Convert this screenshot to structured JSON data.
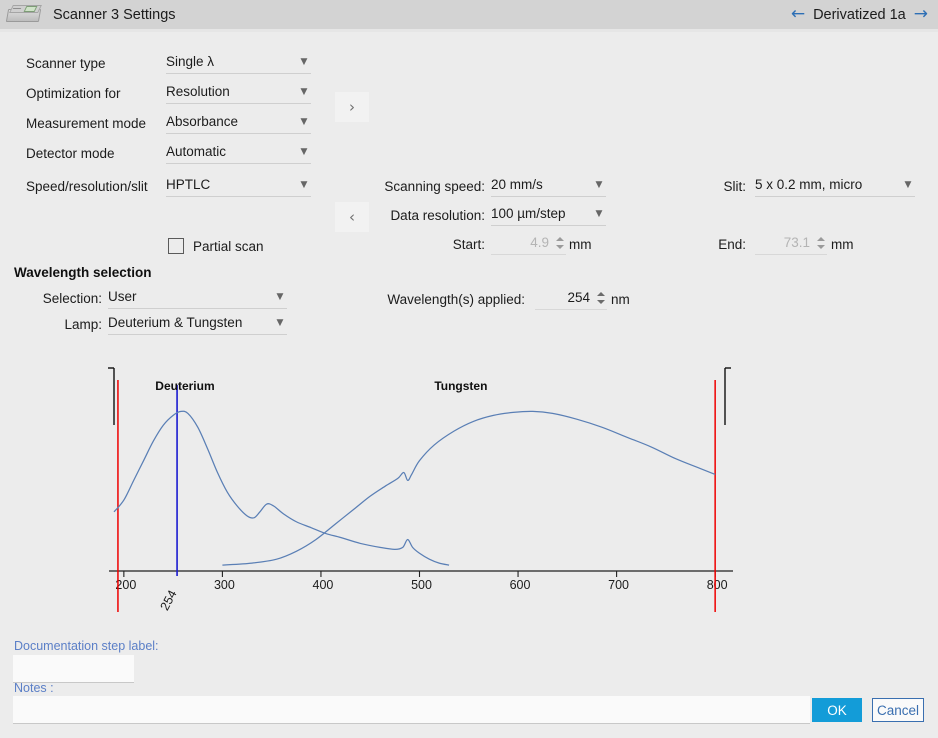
{
  "window": {
    "title": "Scanner 3 Settings",
    "icon": "scanner-icon",
    "nav": {
      "prev_icon": "←",
      "label": "Derivatized 1a",
      "next_icon": "→"
    }
  },
  "left_panel": {
    "fields": [
      {
        "label": "Scanner type",
        "value": "Single λ"
      },
      {
        "label": "Optimization for",
        "value": "Resolution"
      },
      {
        "label": "Measurement mode",
        "value": "Absorbance"
      },
      {
        "label": "Detector mode",
        "value": "Automatic"
      },
      {
        "label": "Speed/resolution/slit",
        "value": "HPTLC"
      }
    ],
    "partial_scan": {
      "label": "Partial scan",
      "checked": false
    }
  },
  "chevrons": {
    "expand": "›",
    "collapse": "‹"
  },
  "middle_panel": {
    "scanning_speed": {
      "label": "Scanning speed:",
      "value": "20 mm/s"
    },
    "data_resolution": {
      "label": "Data resolution:",
      "value": "100 µm/step"
    },
    "start": {
      "label": "Start:",
      "value": "4.9",
      "unit": "mm",
      "disabled": true
    },
    "wavelengths_applied": {
      "label": "Wavelength(s) applied:",
      "value": "254",
      "unit": "nm"
    }
  },
  "right_panel": {
    "slit": {
      "label": "Slit:",
      "value": "5 x 0.2 mm, micro"
    },
    "end": {
      "label": "End:",
      "value": "73.1",
      "unit": "mm",
      "disabled": true
    }
  },
  "wavelength_selection": {
    "title": "Wavelength selection",
    "selection": {
      "label": "Selection:",
      "value": "User"
    },
    "lamp": {
      "label": "Lamp:",
      "value": "Deuterium & Tungsten"
    }
  },
  "chart_data": {
    "type": "line",
    "title": "",
    "xlabel": "",
    "ylabel": "",
    "xlim": [
      190,
      810
    ],
    "ylim": [
      0,
      1
    ],
    "grid": false,
    "legend_position": "inline-annotations",
    "tick_labels": [
      "200",
      "300",
      "400",
      "500",
      "600",
      "700",
      "800"
    ],
    "ticks": [
      200,
      300,
      400,
      500,
      600,
      700,
      800
    ],
    "annotations": [
      {
        "text": "Deuterium",
        "x": 262,
        "y": 0.92
      },
      {
        "text": "Tungsten",
        "x": 542,
        "y": 0.92
      }
    ],
    "markers": [
      {
        "name": "selected-wavelength",
        "label": "254",
        "x": 254,
        "color": "#1a1ad0"
      },
      {
        "name": "range-start",
        "label": "",
        "x": 194,
        "color": "#ee0000"
      },
      {
        "name": "range-end",
        "label": "",
        "x": 800,
        "color": "#ee0000"
      }
    ],
    "series": [
      {
        "name": "Deuterium",
        "color": "#5a7fb5",
        "x": [
          190,
          200,
          210,
          220,
          230,
          240,
          250,
          258,
          265,
          275,
          285,
          295,
          305,
          315,
          325,
          332,
          338,
          345,
          352,
          362,
          375,
          390,
          405,
          420,
          440,
          460,
          475,
          483,
          488,
          493,
          500,
          510,
          520,
          530
        ],
        "y": [
          0.3,
          0.36,
          0.46,
          0.56,
          0.66,
          0.74,
          0.79,
          0.81,
          0.8,
          0.73,
          0.62,
          0.5,
          0.4,
          0.33,
          0.28,
          0.27,
          0.3,
          0.34,
          0.33,
          0.29,
          0.25,
          0.22,
          0.19,
          0.17,
          0.14,
          0.12,
          0.11,
          0.12,
          0.16,
          0.12,
          0.09,
          0.06,
          0.04,
          0.03
        ]
      },
      {
        "name": "Tungsten",
        "color": "#5a7fb5",
        "x": [
          300,
          330,
          355,
          375,
          395,
          415,
          435,
          450,
          465,
          478,
          484,
          488,
          492,
          500,
          515,
          535,
          555,
          575,
          595,
          615,
          635,
          660,
          685,
          710,
          735,
          760,
          785,
          800
        ],
        "y": [
          0.03,
          0.04,
          0.06,
          0.1,
          0.16,
          0.24,
          0.32,
          0.38,
          0.43,
          0.47,
          0.5,
          0.46,
          0.49,
          0.56,
          0.64,
          0.71,
          0.76,
          0.79,
          0.805,
          0.81,
          0.8,
          0.77,
          0.73,
          0.68,
          0.63,
          0.57,
          0.52,
          0.49
        ]
      }
    ]
  },
  "bottom": {
    "doc_step_label": {
      "label": "Documentation step label:",
      "value": "",
      "placeholder": ""
    },
    "notes": {
      "label": "Notes :",
      "value": "",
      "placeholder": ""
    },
    "ok_button": "OK",
    "cancel_button": "Cancel"
  }
}
